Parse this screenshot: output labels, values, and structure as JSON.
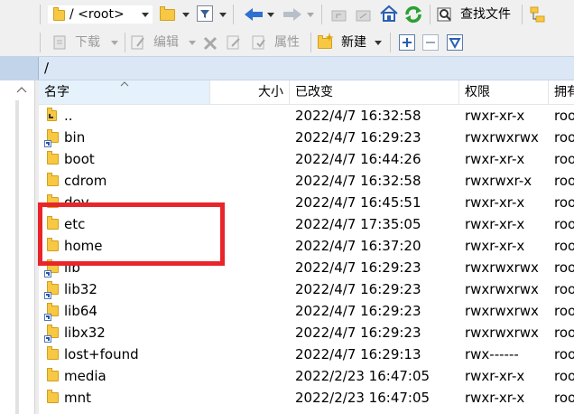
{
  "toolbar1": {
    "path_combo": "/ <root>",
    "find_label": "查找文件"
  },
  "toolbar2": {
    "download_label": "下载",
    "edit_label": "编辑",
    "properties_label": "属性",
    "new_label": "新建"
  },
  "path_bar": {
    "path": "/"
  },
  "header": {
    "name": "名字",
    "size": "大小",
    "modified": "已改变",
    "permissions": "权限",
    "owner": "拥有"
  },
  "rows": [
    {
      "name": "..",
      "modified": "2022/4/7 16:32:58",
      "permissions": "rwxr-xr-x",
      "owner": "root",
      "icon": "parent-dir-icon"
    },
    {
      "name": "bin",
      "modified": "2022/4/7 16:29:23",
      "permissions": "rwxrwxrwx",
      "owner": "root",
      "icon": "folder-link-icon"
    },
    {
      "name": "boot",
      "modified": "2022/4/7 16:44:26",
      "permissions": "rwxr-xr-x",
      "owner": "root",
      "icon": "folder-icon"
    },
    {
      "name": "cdrom",
      "modified": "2022/4/7 16:32:58",
      "permissions": "rwxrwxr-x",
      "owner": "root",
      "icon": "folder-icon"
    },
    {
      "name": "dev",
      "modified": "2022/4/7 16:45:51",
      "permissions": "rwxr-xr-x",
      "owner": "root",
      "icon": "folder-icon"
    },
    {
      "name": "etc",
      "modified": "2022/4/7 17:35:05",
      "permissions": "rwxr-xr-x",
      "owner": "root",
      "icon": "folder-icon"
    },
    {
      "name": "home",
      "modified": "2022/4/7 16:37:20",
      "permissions": "rwxr-xr-x",
      "owner": "root",
      "icon": "folder-icon"
    },
    {
      "name": "lib",
      "modified": "2022/4/7 16:29:23",
      "permissions": "rwxrwxrwx",
      "owner": "root",
      "icon": "folder-link-icon"
    },
    {
      "name": "lib32",
      "modified": "2022/4/7 16:29:23",
      "permissions": "rwxrwxrwx",
      "owner": "root",
      "icon": "folder-link-icon"
    },
    {
      "name": "lib64",
      "modified": "2022/4/7 16:29:23",
      "permissions": "rwxrwxrwx",
      "owner": "root",
      "icon": "folder-link-icon"
    },
    {
      "name": "libx32",
      "modified": "2022/4/7 16:29:23",
      "permissions": "rwxrwxrwx",
      "owner": "root",
      "icon": "folder-link-icon"
    },
    {
      "name": "lost+found",
      "modified": "2022/4/7 16:29:13",
      "permissions": "rwx------",
      "owner": "root",
      "icon": "folder-icon"
    },
    {
      "name": "media",
      "modified": "2022/2/23 16:47:05",
      "permissions": "rwxr-xr-x",
      "owner": "root",
      "icon": "folder-icon"
    },
    {
      "name": "mnt",
      "modified": "2022/2/23 16:47:05",
      "permissions": "rwxr-xr-x",
      "owner": "root",
      "icon": "folder-icon"
    }
  ],
  "colors": {
    "highlight_border": "#e8252a",
    "path_bar_bg": "#c2d4ea",
    "folder_yellow": "#f7c843"
  }
}
